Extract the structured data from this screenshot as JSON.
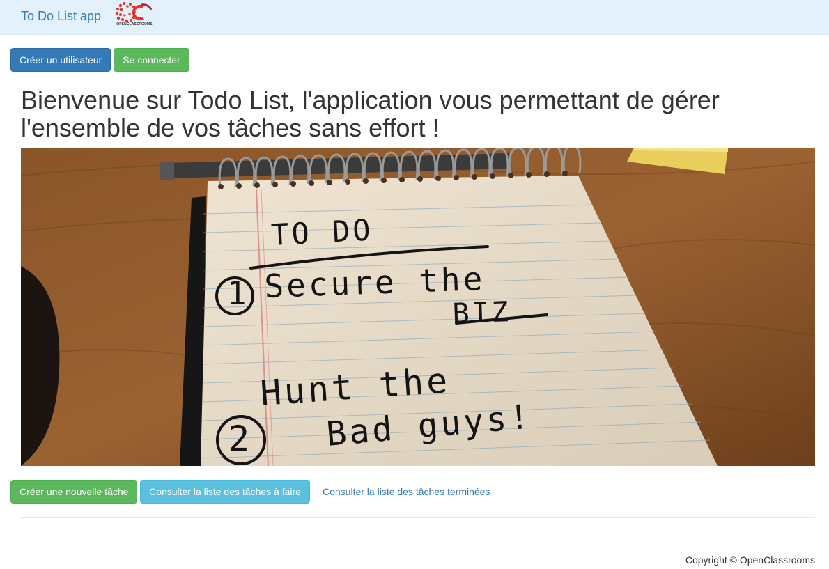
{
  "navbar": {
    "brand": "To Do List app",
    "logo_icon": "openclassrooms-logo",
    "logo_text": "OPENCLASSROOMS",
    "logo_letters": "OC"
  },
  "auth": {
    "create_user": "Créer un utilisateur",
    "login": "Se connecter"
  },
  "main": {
    "headline": "Bienvenue sur Todo List, l'application vous permettant de gérer l'ensemble de vos tâches sans effort !",
    "hero_image": {
      "line1": "TO DO",
      "line2_num": "1",
      "line2": "Secure the",
      "line3": "BIZ",
      "line4": "Hunt the",
      "line5_num": "2",
      "line5": "Bad guys!"
    }
  },
  "actions": {
    "create_task": "Créer une nouvelle tâche",
    "todo_list": "Consulter la liste des tâches à faire",
    "done_list": "Consulter la liste des tâches terminées"
  },
  "footer": {
    "copyright": "Copyright © OpenClassrooms"
  },
  "colors": {
    "primary": "#337ab7",
    "success": "#5cb85c",
    "info": "#5bc0de",
    "navbar_bg": "#e3f1fd"
  }
}
